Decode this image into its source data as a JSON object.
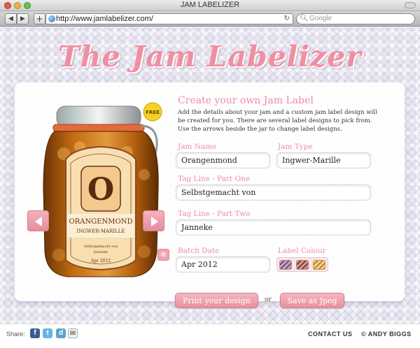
{
  "window": {
    "title": "JAM LABELIZER"
  },
  "browser": {
    "url": "http://www.jamlabelizer.com/",
    "search_placeholder": "Google"
  },
  "logo": "The Jam Labelizer",
  "form": {
    "heading": "Create your own Jam Label",
    "description": "Add the details about your jam and a custom jam label design will be created for you. There are several label designs to pick from. Use the arrows beside the jar to change label designs.",
    "jam_name_label": "Jam Name",
    "jam_name_value": "Orangenmond",
    "jam_type_label": "Jam Type",
    "jam_type_value": "Ingwer-Marille",
    "tagline1_label": "Tag Line - Part One",
    "tagline1_value": "Selbstgemacht von",
    "tagline2_label": "Tag Line - Part Two",
    "tagline2_value": "Janneke",
    "batch_date_label": "Batch Date",
    "batch_date_value": "Apr 2012",
    "label_colour_label": "Label Colour"
  },
  "buttons": {
    "print": "Print your design",
    "or": "or",
    "save": "Save as Jpeg"
  },
  "jar": {
    "badge": "FREE",
    "initial": "O",
    "name": "ORANGENMOND",
    "type": "INGWER-MARILLE",
    "tagline1": "Selbstgemacht von",
    "tagline2": "Janneke",
    "date": "Apr 2012"
  },
  "footer": {
    "share_label": "Share:",
    "contact": "CONTACT US",
    "credit": "© ANDY BIGGS"
  },
  "colors": {
    "accent": "#ee8e9d",
    "button": "#e8909f",
    "jam": "#c06a12"
  }
}
